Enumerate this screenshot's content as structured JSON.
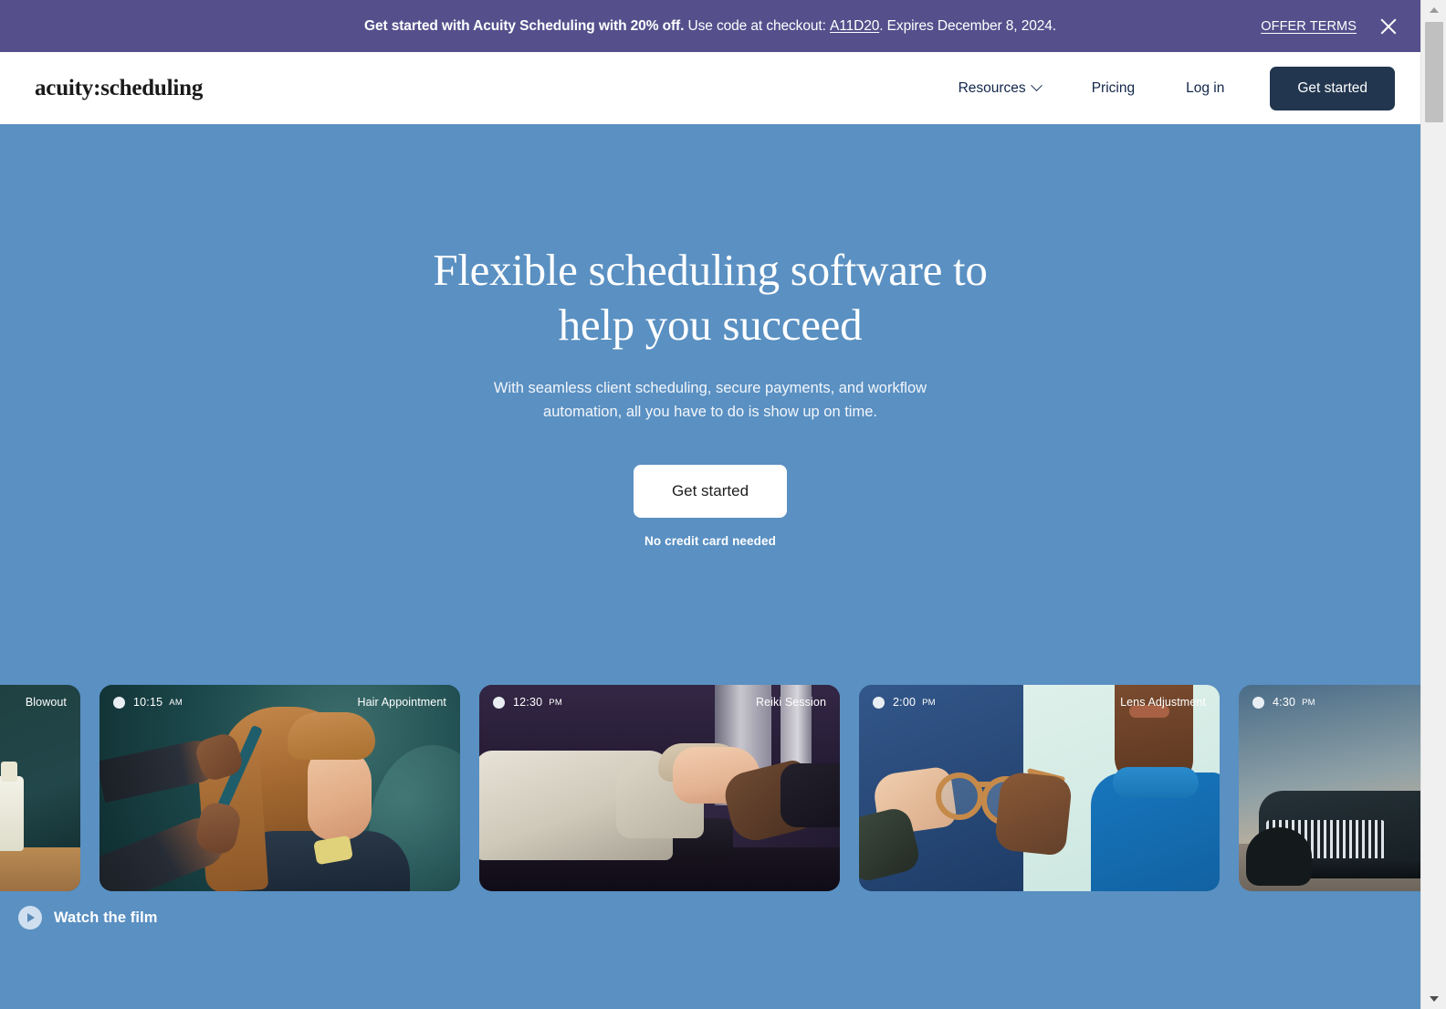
{
  "promo": {
    "headline": "Get started with Acuity Scheduling with 20% off.",
    "body_before": "Use code at checkout:",
    "code": "A11D20",
    "body_after": ". Expires December 8, 2024.",
    "offer_terms": "OFFER TERMS",
    "close_icon": "close-icon",
    "background_color": "#55508c"
  },
  "nav": {
    "brand": "acuity:scheduling",
    "links": [
      {
        "label": "Resources",
        "has_dropdown": true
      },
      {
        "label": "Pricing",
        "has_dropdown": false
      },
      {
        "label": "Log in",
        "has_dropdown": false
      }
    ],
    "cta_label": "Get started",
    "cta_color": "#22364f"
  },
  "hero": {
    "title": "Flexible scheduling software to help you succeed",
    "subtitle": "With seamless client scheduling, secure payments, and workflow automation, all you have to do is show up on time.",
    "cta_label": "Get started",
    "note": "No credit card needed",
    "background_color": "#5a90c2",
    "watch_film_label": "Watch the film",
    "play_icon": "play-icon"
  },
  "cards": [
    {
      "time": "",
      "ampm": "",
      "service": "Blowout",
      "has_dot": false
    },
    {
      "time": "10:15",
      "ampm": "AM",
      "service": "Hair Appointment",
      "has_dot": true
    },
    {
      "time": "12:30",
      "ampm": "PM",
      "service": "Reiki Session",
      "has_dot": true
    },
    {
      "time": "2:00",
      "ampm": "PM",
      "service": "Lens Adjustment",
      "has_dot": true
    },
    {
      "time": "4:30",
      "ampm": "PM",
      "service": "",
      "has_dot": true
    }
  ],
  "browser": {
    "scrollbar_up_icon": "chevron-up-icon",
    "scrollbar_down_icon": "chevron-down-icon"
  }
}
